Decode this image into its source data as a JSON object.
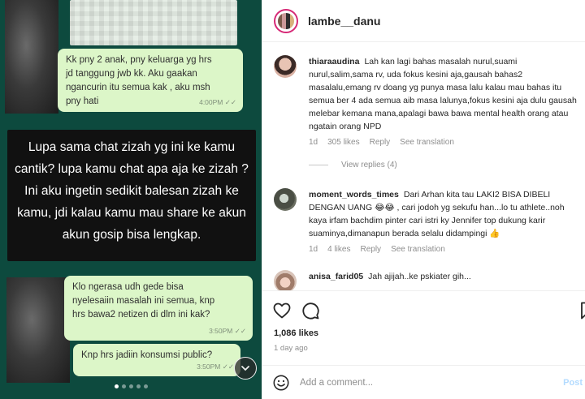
{
  "media": {
    "bubbles": [
      {
        "text": "Kk pny 2 anak, pny keluarga yg hrs\njd tanggung jwb kk. Aku gaakan\nngancurin itu semua kak , aku msh\npny hati",
        "time": "4:00PM ✓✓"
      },
      {
        "text": "Klo ngerasa udh gede bisa\nnyelesaiin masalah ini semua, knp\nhrs bawa2 netizen di dlm ini kak?",
        "time": "3:50PM ✓✓"
      },
      {
        "text": "Knp hrs jadiin konsumsi public?",
        "time": "3:50PM ✓✓"
      }
    ],
    "caption": "Lupa sama chat zizah yg ini ke kamu cantik? lupa kamu chat apa aja ke zizah ? Ini aku ingetin sedikit balesan zizah ke kamu, jdi kalau kamu mau share ke akun akun gosip bisa lengkap."
  },
  "post": {
    "owner": "lambe__danu",
    "more_icon": "more-icon"
  },
  "comments": [
    {
      "user": "thiaraaudina",
      "text": "Lah kan lagi bahas masalah nurul,suami nurul,salim,sama rv, uda fokus kesini aja,gausah bahas2 masalalu,emang rv doang yg punya masa lalu kalau mau bahas itu semua ber 4 ada semua aib masa lalunya,fokus kesini aja dulu gausah melebar kemana mana,apalagi bawa bawa mental health orang atau ngatain orang NPD",
      "age": "1d",
      "likes": "305 likes",
      "reply": "Reply",
      "translate": "See translation",
      "view_replies": "View replies (4)"
    },
    {
      "user": "moment_words_times",
      "text": "Dari Arhan kita tau LAKI2 BISA DIBELI DENGAN UANG 😂😂 , cari jodoh yg sekufu han...lo tu athlete..noh kaya irfam bachdim pinter cari istri ky Jennifer top dukung karir suaminya,dimanapun berada selalu didampingi 👍",
      "age": "1d",
      "likes": "4 likes",
      "reply": "Reply",
      "translate": "See translation"
    },
    {
      "user": "anisa_farid05",
      "text": "Jah ajijah..ke pskiater gih..."
    }
  ],
  "actions": {
    "icons": [
      "heart-icon",
      "comment-icon",
      "bookmark-icon"
    ],
    "likes": "1,086 likes",
    "date": "1 day ago"
  },
  "composer": {
    "placeholder": "Add a comment...",
    "post_label": "Post"
  },
  "colors": {
    "chat_background": "#0d4a3e",
    "bubble": "#dcf6c8",
    "link_blue": "#0095f6"
  }
}
